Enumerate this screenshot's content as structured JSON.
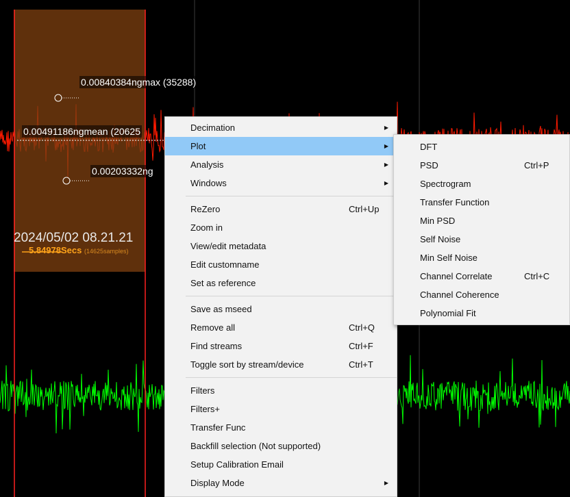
{
  "labels": {
    "max": "0.00840384ngmax (35288)",
    "mean": "0.00491186ngmean (20625",
    "min": "0.00203332ng",
    "timestamp": "2024/05/02 08.21.21",
    "duration": "5.84978Secs",
    "samples": "(14625samples)"
  },
  "colors": {
    "red_trace": "#ff1a00",
    "green_trace": "#00ff00",
    "selection": "#7a3d10",
    "menu_bg": "#f2f2f2",
    "menu_highlight": "#91c9f7"
  },
  "context_menu": {
    "items": [
      {
        "label": "Decimation",
        "shortcut": "",
        "submenu": true
      },
      {
        "label": "Plot",
        "shortcut": "",
        "submenu": true
      },
      {
        "label": "Analysis",
        "shortcut": "",
        "submenu": true
      },
      {
        "label": "Windows",
        "shortcut": "",
        "submenu": true
      },
      {
        "label": "ReZero",
        "shortcut": "Ctrl+Up"
      },
      {
        "label": "Zoom in",
        "shortcut": ""
      },
      {
        "label": "View/edit metadata",
        "shortcut": ""
      },
      {
        "label": "Edit customname",
        "shortcut": ""
      },
      {
        "label": "Set as reference",
        "shortcut": ""
      },
      {
        "label": "Save as mseed",
        "shortcut": ""
      },
      {
        "label": "Remove all",
        "shortcut": "Ctrl+Q"
      },
      {
        "label": "Find streams",
        "shortcut": "Ctrl+F"
      },
      {
        "label": "Toggle sort by stream/device",
        "shortcut": "Ctrl+T"
      },
      {
        "label": "Filters",
        "shortcut": ""
      },
      {
        "label": "Filters+",
        "shortcut": ""
      },
      {
        "label": "Transfer Func",
        "shortcut": ""
      },
      {
        "label": "Backfill selection (Not supported)",
        "shortcut": ""
      },
      {
        "label": "Setup Calibration Email",
        "shortcut": ""
      },
      {
        "label": "Display Mode",
        "shortcut": "",
        "submenu": true
      }
    ]
  },
  "plot_submenu": {
    "items": [
      {
        "label": "DFT",
        "shortcut": ""
      },
      {
        "label": "PSD",
        "shortcut": "Ctrl+P"
      },
      {
        "label": "Spectrogram",
        "shortcut": ""
      },
      {
        "label": "Transfer Function",
        "shortcut": ""
      },
      {
        "label": "Min PSD",
        "shortcut": ""
      },
      {
        "label": "Self Noise",
        "shortcut": ""
      },
      {
        "label": "Min Self Noise",
        "shortcut": ""
      },
      {
        "label": "Channel Correlate",
        "shortcut": "Ctrl+C"
      },
      {
        "label": "Channel Coherence",
        "shortcut": ""
      },
      {
        "label": "Polynomial Fit",
        "shortcut": ""
      }
    ]
  }
}
